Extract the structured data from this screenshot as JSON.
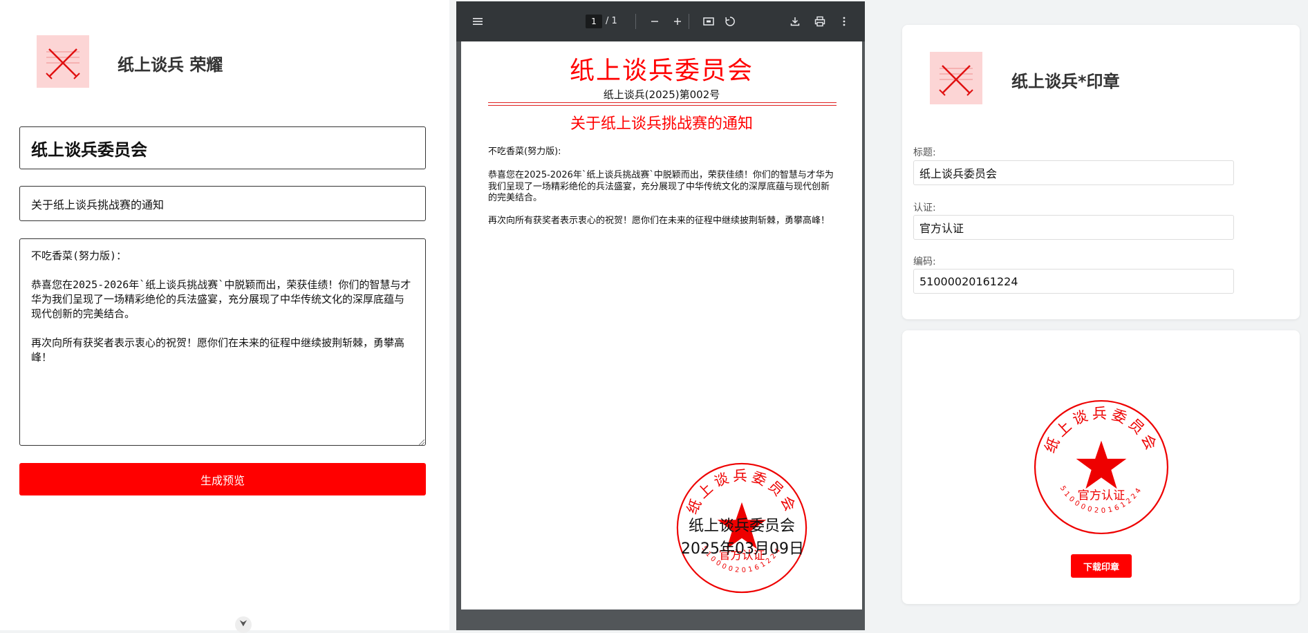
{
  "left": {
    "app_title": "纸上谈兵 荣耀",
    "title_value": "纸上谈兵委员会",
    "subject_value": "关于纸上谈兵挑战赛的通知",
    "body_value": "不吃香菜(努力版)：\n\n恭喜您在2025-2026年`纸上谈兵挑战赛`中脱颖而出，荣获佳绩！你们的智慧与才华为我们呈现了一场精彩绝伦的兵法盛宴，充分展现了中华传统文化的深厚底蕴与现代创新的完美结合。\n\n再次向所有获奖者表示衷心的祝贺！愿你们在未来的征程中继续披荆斩棘，勇攀高峰！",
    "preview_button": "生成预览"
  },
  "viewer": {
    "page_current": "1",
    "page_total": "/ 1",
    "icons": [
      "menu-icon",
      "zoom-out-icon",
      "zoom-in-icon",
      "fit-page-icon",
      "rotate-icon",
      "download-icon",
      "print-icon",
      "more-icon"
    ],
    "document": {
      "header": "纸上谈兵委员会",
      "doc_number": "纸上谈兵(2025)第002号",
      "title": "关于纸上谈兵挑战赛的通知",
      "salutation": "不吃香菜(努力版):",
      "paragraph1": "恭喜您在2025-2026年`纸上谈兵挑战赛`中脱颖而出，荣获佳绩！你们的智慧与才华为我们呈现了一场精彩绝伦的兵法盛宴，充分展现了中华传统文化的深厚底蕴与现代创新的完美结合。",
      "paragraph2": "再次向所有获奖者表示衷心的祝贺！愿你们在未来的征程中继续披荆斩棘，勇攀高峰！",
      "signature": "纸上谈兵委员会",
      "date": "2025年03月09日"
    }
  },
  "right": {
    "app_title": "纸上谈兵*印章",
    "title_label": "标题:",
    "title_value": "纸上谈兵委员会",
    "cert_label": "认证:",
    "cert_value": "官方认证",
    "code_label": "编码:",
    "code_value": "51000020161224",
    "download_button": "下载印章"
  },
  "seal": {
    "ring_text": "纸上谈兵委员会",
    "center_text": "官方认证",
    "code_text": "51000020161224"
  },
  "colors": {
    "accent": "#ff0000",
    "logo_bg": "#fcd5d5",
    "viewer_toolbar": "#323639",
    "viewer_bg": "#525659"
  }
}
